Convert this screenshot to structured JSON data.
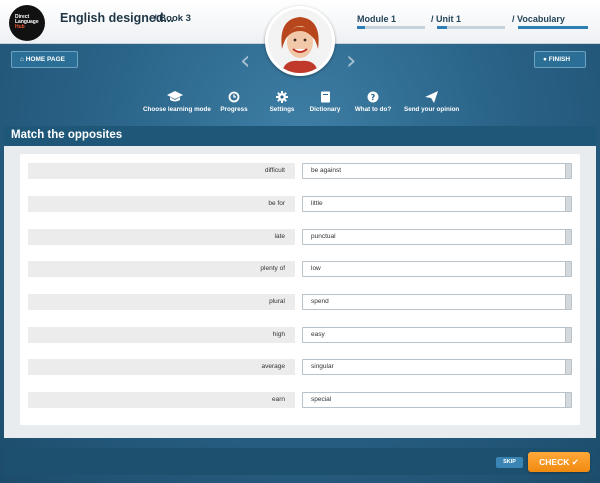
{
  "header": {
    "logo_lines": [
      "Direct",
      "Language",
      "Hub"
    ],
    "course_title": "English designed...",
    "book": "/ Book 3",
    "breadcrumbs": [
      {
        "label": "Module 1",
        "progress": 0.12
      },
      {
        "label": "/ Unit 1",
        "progress": 0.15
      },
      {
        "label": "/ Vocabulary",
        "progress": 1.0
      }
    ]
  },
  "buttons": {
    "home": "⌂ HOME PAGE",
    "finish": "● FINISH",
    "skip": "SKIP",
    "check": "CHECK ✔"
  },
  "toolbar": [
    {
      "label": "Choose learning mode",
      "icon": "graduation-cap-icon"
    },
    {
      "label": "Progress",
      "icon": "history-icon"
    },
    {
      "label": "Settings",
      "icon": "gear-icon"
    },
    {
      "label": "Dictionary",
      "icon": "book-icon"
    },
    {
      "label": "What to do?",
      "icon": "question-icon"
    },
    {
      "label": "Send your opinion",
      "icon": "paper-plane-icon"
    }
  ],
  "exercise": {
    "title": "Match the opposites",
    "pairs": [
      {
        "left": "difficult",
        "right": "be against"
      },
      {
        "left": "be for",
        "right": "little"
      },
      {
        "left": "late",
        "right": "punctual"
      },
      {
        "left": "plenty of",
        "right": "low"
      },
      {
        "left": "plural",
        "right": "spend"
      },
      {
        "left": "high",
        "right": "easy"
      },
      {
        "left": "average",
        "right": "singular"
      },
      {
        "left": "earn",
        "right": "special"
      }
    ]
  }
}
